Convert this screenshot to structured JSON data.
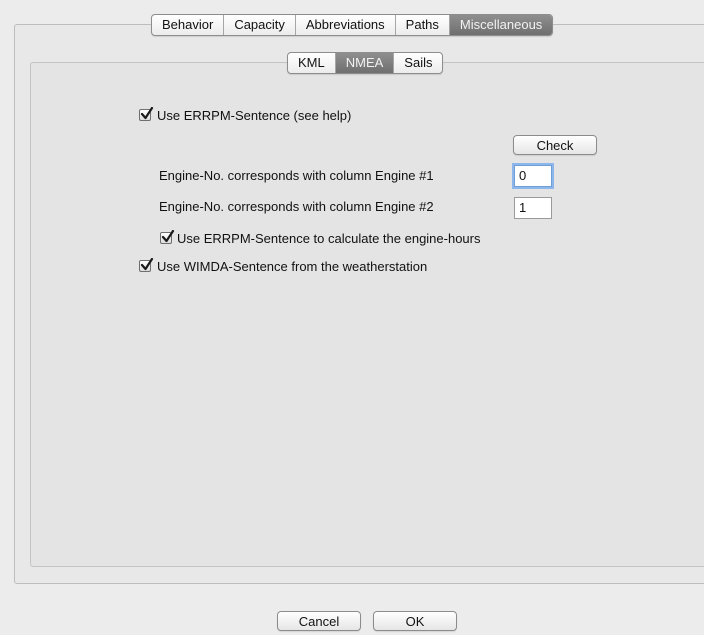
{
  "top_tabs": [
    "Behavior",
    "Capacity",
    "Abbreviations",
    "Paths",
    "Miscellaneous"
  ],
  "sub_tabs": [
    "KML",
    "NMEA",
    "Sails"
  ],
  "nmea": {
    "use_errpm_label": "Use ERRPM-Sentence (see help)",
    "use_errpm_checked": true,
    "check_button": "Check",
    "engine1_label": "Engine-No. corresponds with column Engine #1",
    "engine1_value": "0",
    "engine2_label": "Engine-No. corresponds with column Engine #2",
    "engine2_value": "1",
    "engine_hours_label": "Use ERRPM-Sentence to calculate the engine-hours",
    "engine_hours_checked": true,
    "use_wimda_label": "Use WIMDA-Sentence from the weatherstation",
    "use_wimda_checked": true
  },
  "footer": {
    "cancel": "Cancel",
    "ok": "OK"
  }
}
